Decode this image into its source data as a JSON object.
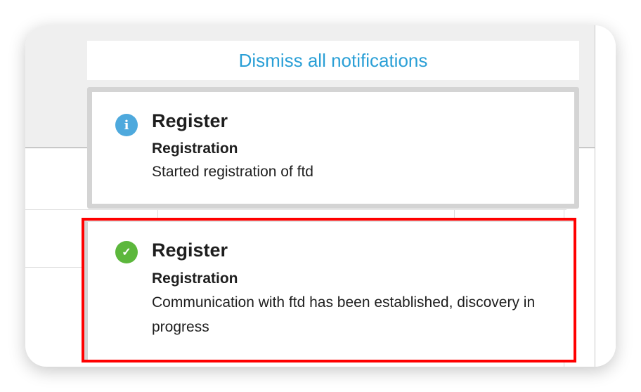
{
  "dismiss_all_label": "Dismiss all notifications",
  "notifications": [
    {
      "type": "info",
      "icon": "info-icon",
      "color": "#4ea9dd",
      "title": "Register",
      "category": "Registration",
      "message": "Started registration of ftd"
    },
    {
      "type": "success",
      "icon": "check-circle-icon",
      "color": "#5cb73c",
      "title": "Register",
      "category": "Registration",
      "message": "Communication with ftd has been established, discovery in progress",
      "highlighted": true
    }
  ],
  "colors": {
    "link": "#2a9fd6",
    "highlight": "#ff0000"
  }
}
